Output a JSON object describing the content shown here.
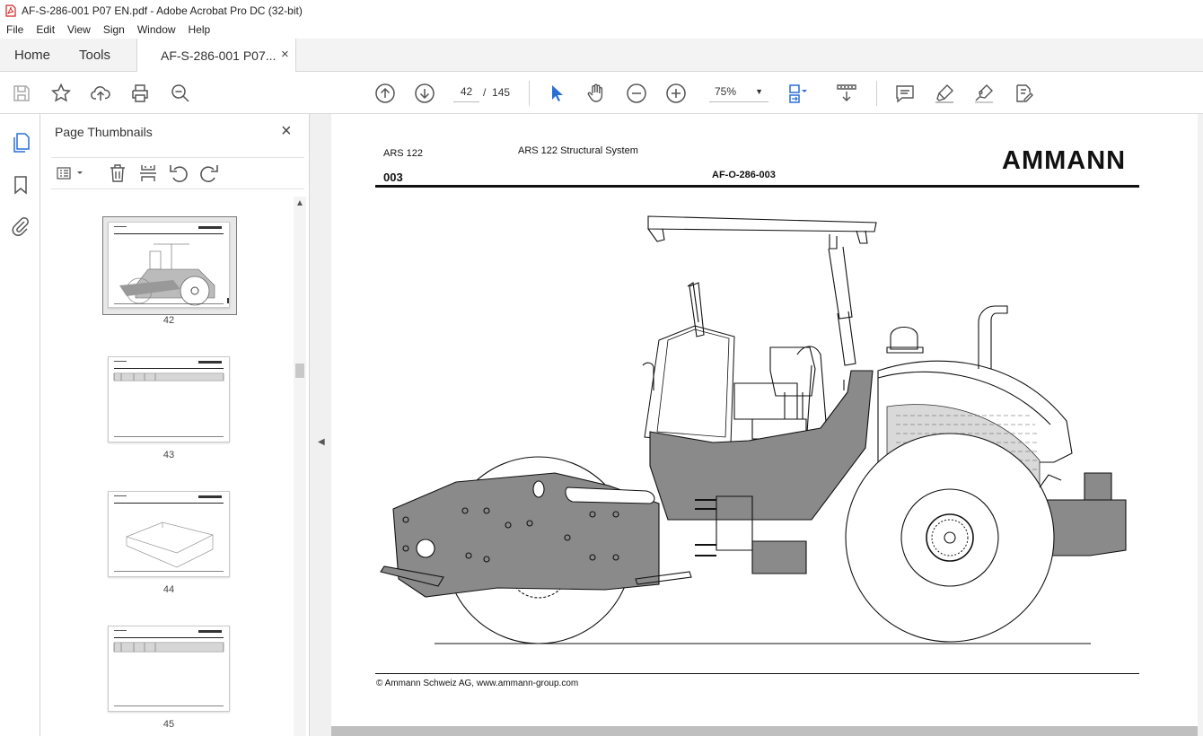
{
  "window": {
    "title": "AF-S-286-001 P07 EN.pdf - Adobe Acrobat Pro DC (32-bit)"
  },
  "menu": [
    "File",
    "Edit",
    "View",
    "Sign",
    "Window",
    "Help"
  ],
  "tabs": {
    "home": "Home",
    "tools": "Tools",
    "document": "AF-S-286-001 P07...",
    "close": "×"
  },
  "toolbar": {
    "current_page": "42",
    "page_separator": "/",
    "total_pages": "145",
    "zoom": "75%"
  },
  "thumbnails": {
    "title": "Page Thumbnails",
    "close": "×",
    "items": [
      {
        "page": "42",
        "selected": true
      },
      {
        "page": "43",
        "selected": false
      },
      {
        "page": "44",
        "selected": false
      },
      {
        "page": "45",
        "selected": false
      }
    ]
  },
  "document": {
    "model": "ARS 122",
    "title": "ARS 122 Structural System",
    "code": "003",
    "doc_number": "AF-O-286-003",
    "brand": "AMMANN",
    "footer": "© Ammann Schweiz AG, www.ammann-group.com"
  },
  "icons": {
    "save": "save-icon",
    "bookmark": "star-icon",
    "upload": "upload-icon",
    "print": "print-icon",
    "find": "zoom-search-icon",
    "prev": "arrow-up-circle-icon",
    "next": "arrow-down-circle-icon",
    "select": "cursor-arrow-icon",
    "hand": "hand-icon",
    "zoom_out": "minus-circle-icon",
    "zoom_in": "plus-circle-icon"
  }
}
